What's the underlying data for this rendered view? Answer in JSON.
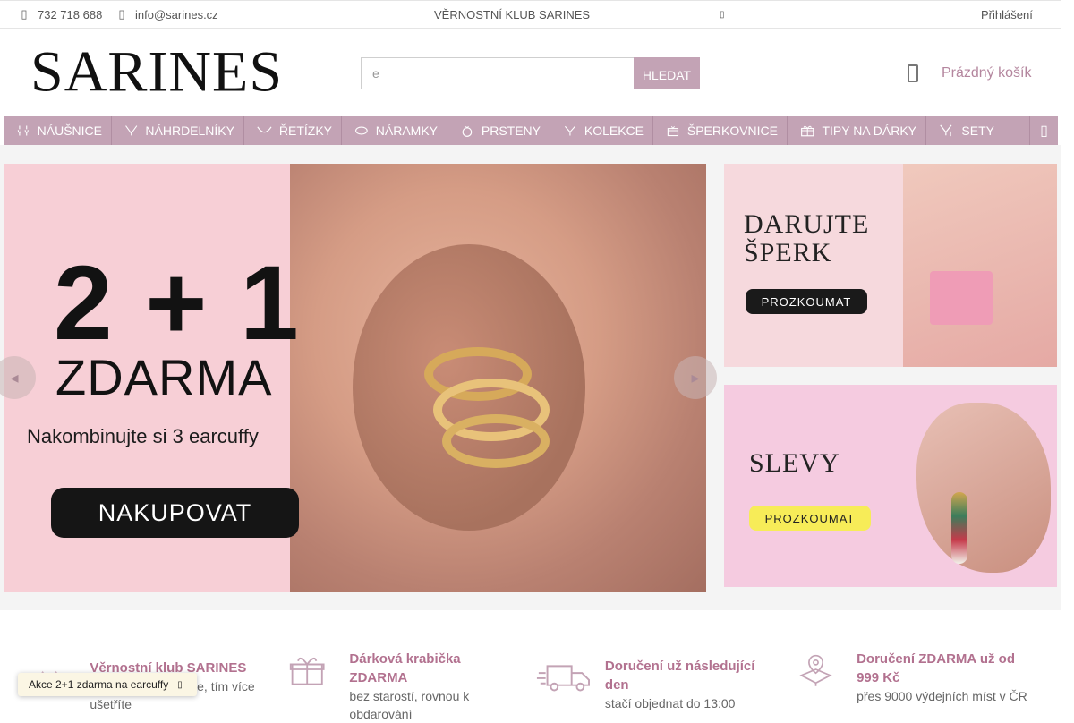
{
  "topbar": {
    "phone": "732 718 688",
    "email": "info@sarines.cz",
    "club": "VĚRNOSTNÍ KLUB SARINES",
    "login": "Přihlášení"
  },
  "header": {
    "logo": "SARINES",
    "search_value": "e",
    "search_button": "HLEDAT",
    "cart_label": "Prázdný košík"
  },
  "nav": {
    "items": [
      {
        "label": "NÁUŠNICE",
        "icon": "earrings-icon"
      },
      {
        "label": "NÁHRDELNÍKY",
        "icon": "necklace-icon"
      },
      {
        "label": "ŘETÍZKY",
        "icon": "chain-icon"
      },
      {
        "label": "NÁRAMKY",
        "icon": "bracelet-icon"
      },
      {
        "label": "PRSTENY",
        "icon": "ring-icon"
      },
      {
        "label": "KOLEKCE",
        "icon": "collection-icon"
      },
      {
        "label": "ŠPERKOVNICE",
        "icon": "jewelry-box-icon"
      },
      {
        "label": "TIPY NA DÁRKY",
        "icon": "gift-icon"
      },
      {
        "label": "SETY",
        "icon": "set-icon"
      }
    ]
  },
  "slider": {
    "headline": "2 + 1",
    "sub": "ZDARMA",
    "desc": "Nakombinujte si 3 earcuffy",
    "cta": "NAKUPOVAT"
  },
  "promos": [
    {
      "title_line1": "DARUJTE",
      "title_line2": "ŠPERK",
      "button": "PROZKOUMAT"
    },
    {
      "title_line1": "SLEVY",
      "button": "PROZKOUMAT"
    }
  ],
  "benefits": [
    {
      "title": "Věrnostní klub SARINES",
      "desc": "Čím více nakupujete, tím více ušetříte",
      "icon": "loyalty-icon"
    },
    {
      "title": "Dárková krabička ZDARMA",
      "desc": "bez starostí, rovnou k obdarování",
      "icon": "gift-box-icon"
    },
    {
      "title": "Doručení už následující den",
      "desc": "stačí objednat do 13:00",
      "icon": "truck-icon"
    },
    {
      "title": "Doručení ZDARMA už od 999 Kč",
      "desc": "přes 9000 výdejních míst v ČR",
      "icon": "map-pin-icon"
    }
  ],
  "toast": {
    "text": "Akce 2+1 zdarma na earcuffy"
  },
  "colors": {
    "accent": "#c3a3b5",
    "accent_text": "#b2718f",
    "banner_bg": "#f7cfd6"
  }
}
